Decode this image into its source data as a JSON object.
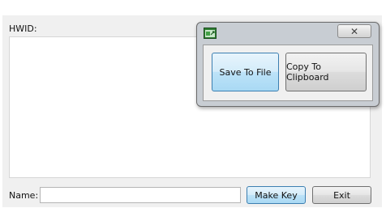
{
  "main": {
    "hwid_label": "HWID:",
    "hwid_value": "",
    "name_label": "Name:",
    "name_value": "",
    "make_key_label": "Make Key",
    "exit_label": "Exit"
  },
  "popup": {
    "icon": "app-icon",
    "close_label": "✕",
    "save_label": "Save To File",
    "copy_label": "Copy To Clipboard"
  },
  "colors": {
    "focused_button_border": "#3c7fb1",
    "focused_button_fill": "#bde3f8",
    "dialog_frame": "#c8cdd3"
  }
}
